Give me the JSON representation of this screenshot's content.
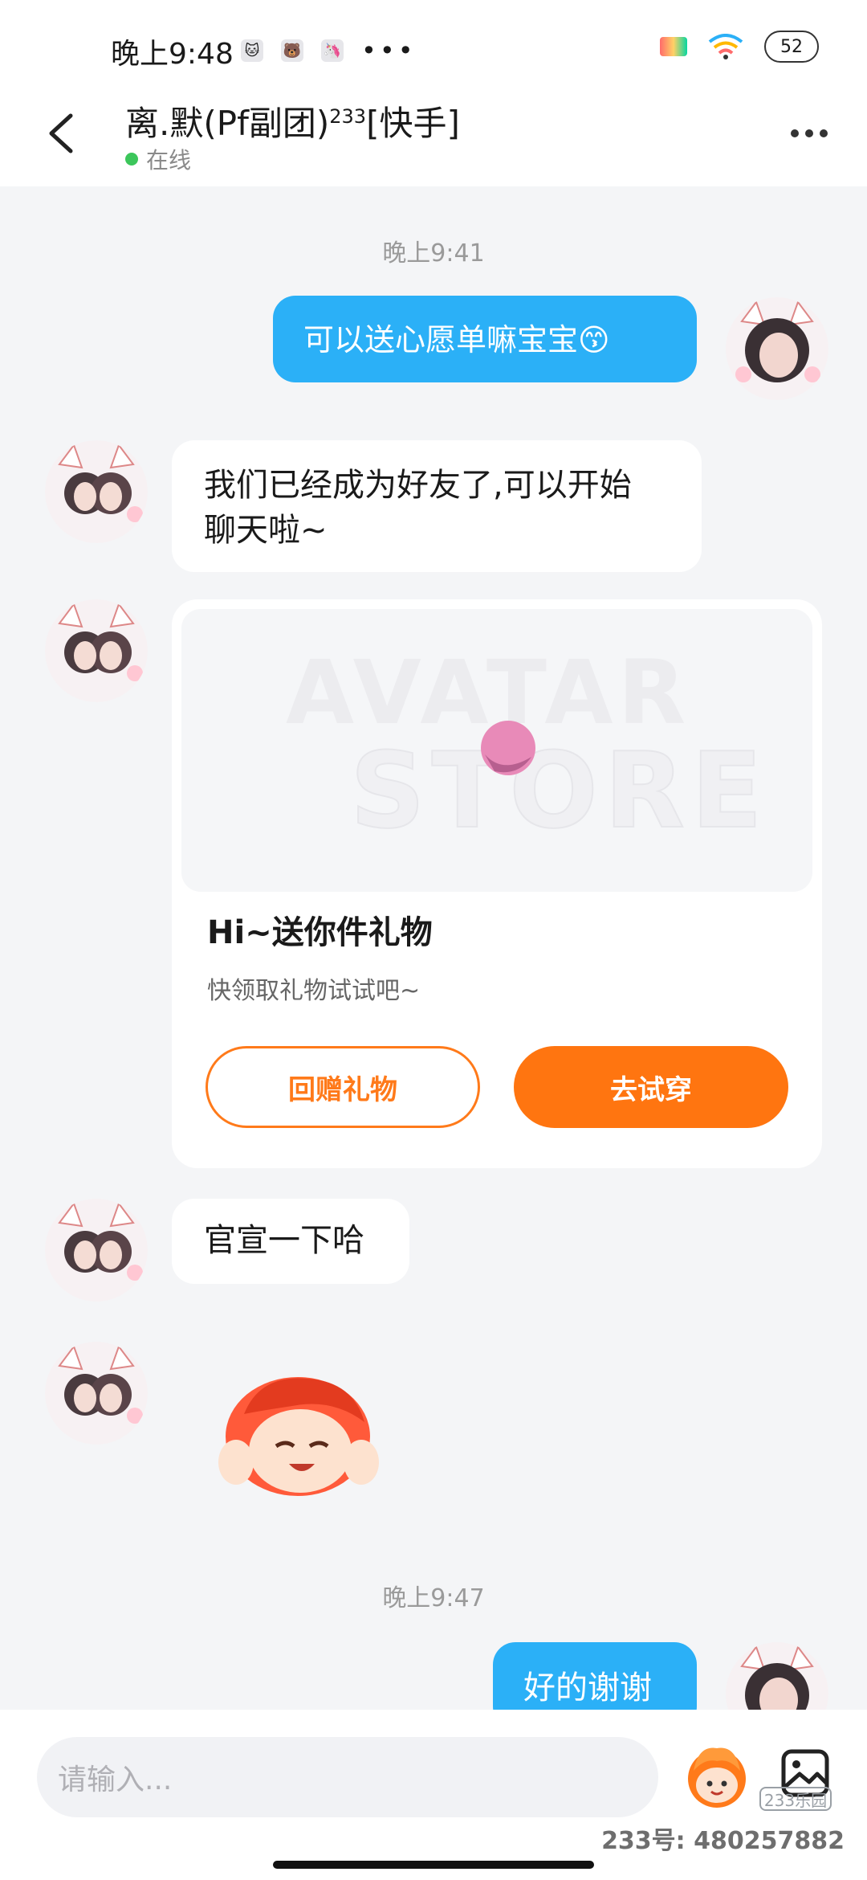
{
  "status_bar": {
    "time": "晚上9:48",
    "battery": "52"
  },
  "header": {
    "title": "离.默(Pf副团)",
    "title_sup": "233",
    "title_suffix": "[快手]",
    "status": "在线"
  },
  "chat": {
    "timestamp_1": "晚上9:41",
    "msg_out_1": "可以送心愿单嘛宝宝😙",
    "msg_in_1_line1": "我们已经成为好友了,可以开始",
    "msg_in_1_line2": "聊天啦~",
    "gift": {
      "watermark_1": "AVATAR",
      "watermark_2": "STORE",
      "title": "Hi~送你件礼物",
      "subtitle": "快领取礼物试试吧~",
      "btn_return": "回赠礼物",
      "btn_try": "去试穿"
    },
    "msg_in_2": "官宣一下哈",
    "timestamp_2": "晚上9:47",
    "msg_out_2": "好的谢谢"
  },
  "input": {
    "placeholder": "请输入..."
  },
  "watermark": {
    "logo": "233乐园",
    "id": "233号: 480257882"
  },
  "colors": {
    "accent_blue": "#2bb0f7",
    "accent_orange": "#ff7510",
    "online": "#3cc65b"
  }
}
